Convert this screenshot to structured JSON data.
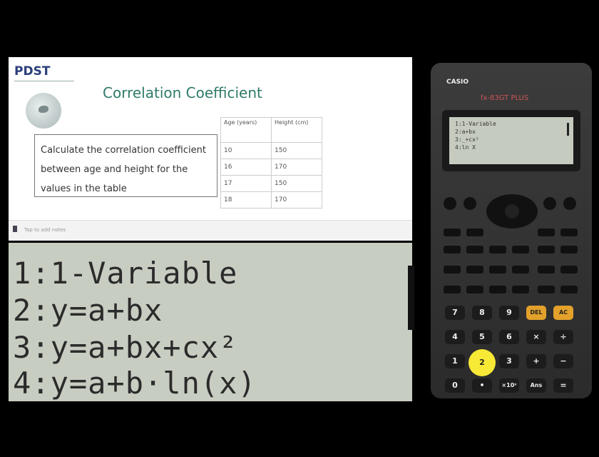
{
  "slide": {
    "logo": "PDST",
    "title": "Correlation Coefficient",
    "task": "Calculate the correlation coefficient between age and height for the values in the table",
    "table": {
      "headers": [
        "Age (years)",
        "Height (cm)"
      ],
      "rows": [
        [
          "10",
          "150"
        ],
        [
          "16",
          "170"
        ],
        [
          "17",
          "150"
        ],
        [
          "18",
          "170"
        ]
      ]
    }
  },
  "notes_bar": {
    "text": "Tap to add notes"
  },
  "zoomed_display": {
    "lines": [
      "1:1-Variable",
      "2:y=a+bx",
      "3:y=a+bx+cx²",
      "4:y=a+b·ln(x)"
    ]
  },
  "calculator": {
    "brand": "CASIO",
    "model": "fx-83GT PLUS",
    "screen_lines": [
      "1:1-Variable",
      "2:a+bx",
      "3:_+cx²",
      "4:ln X"
    ],
    "keys": {
      "row1": [
        "7",
        "8",
        "9",
        "DEL",
        "AC"
      ],
      "row2": [
        "4",
        "5",
        "6",
        "×",
        "÷"
      ],
      "row3": [
        "1",
        "2",
        "3",
        "+",
        "−"
      ],
      "row4": [
        "0",
        "•",
        "×10ˣ",
        "Ans",
        "="
      ]
    },
    "highlighted_key": "2",
    "colors": {
      "body": "#333333",
      "accent_keys": "#e3a12b",
      "highlight": "#f7e936"
    }
  }
}
